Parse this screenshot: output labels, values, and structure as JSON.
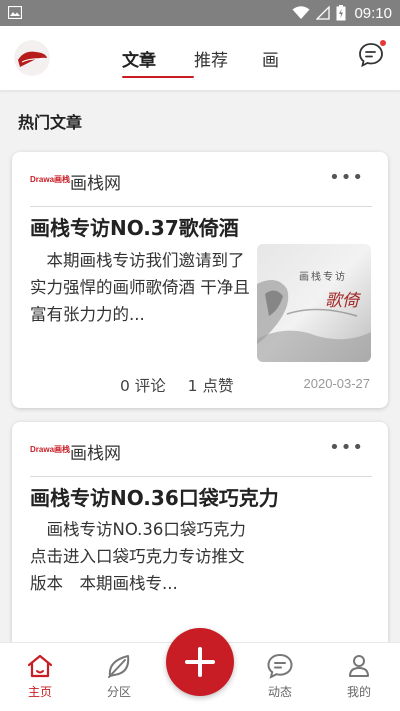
{
  "status_bar": {
    "time": "09:10"
  },
  "header": {
    "tabs": [
      {
        "label": "文章",
        "active": true
      },
      {
        "label": "推荐",
        "active": false
      },
      {
        "label": "画",
        "active": false
      }
    ]
  },
  "section": {
    "title": "热门文章"
  },
  "cards": [
    {
      "source_logo": "Drawa画栈",
      "source_name": "画栈网",
      "title": "画栈专访NO.37歌倚酒",
      "excerpt": "　本期画栈专访我们邀请到了 实力强悍的画师歌倚酒 干净且富有张力力的...",
      "thumb_caption": "画栈专访",
      "thumb_name": "歌倚",
      "comments": "0 评论",
      "likes": "1 点赞",
      "date": "2020-03-27"
    },
    {
      "source_logo": "Drawa画栈",
      "source_name": "画栈网",
      "title": "画栈专访NO.36口袋巧克力",
      "excerpt": "　画栈专访NO.36口袋巧克力 点击进入口袋巧克力专访推文版本　本期画栈专..."
    }
  ],
  "bottom_nav": [
    {
      "label": "主页",
      "icon": "home-icon",
      "active": true
    },
    {
      "label": "分区",
      "icon": "leaf-icon",
      "active": false
    },
    {
      "label": "动态",
      "icon": "chat-icon",
      "active": false
    },
    {
      "label": "我的",
      "icon": "person-icon",
      "active": false
    }
  ],
  "colors": {
    "accent": "#c81d25",
    "background": "#f2f2f2"
  }
}
